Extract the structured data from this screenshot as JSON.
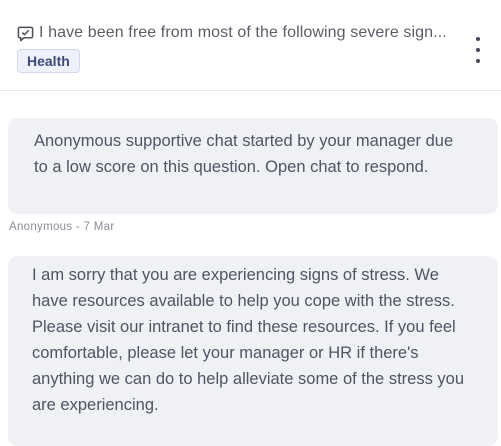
{
  "header": {
    "question": "I have been free from most of the following severe sign...",
    "tag": "Health",
    "icons": {
      "question_icon": "chat-bubble-icon",
      "menu_icon": "more-vertical-icon"
    }
  },
  "messages": [
    {
      "text": "Anonymous supportive chat started by your manager due to a low score on this question. Open chat to respond.",
      "meta": "Anonymous - 7 Mar"
    },
    {
      "text": "I am sorry that you are experiencing signs of stress. We have resources available to help you cope with the stress. Please visit our intranet to find these resources. If you feel comfortable, please let your manager or HR if there's anything we can do to help alleviate some of the stress you are experiencing."
    }
  ],
  "colors": {
    "tag_bg": "#eef1fb",
    "tag_text": "#3d4a7a",
    "bubble_bg": "#f0f1f5"
  }
}
